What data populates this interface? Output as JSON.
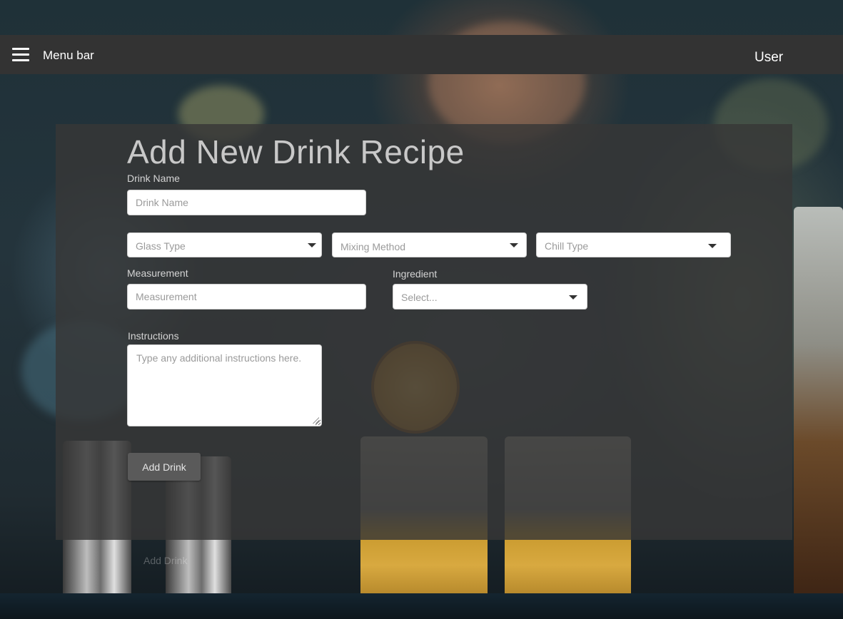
{
  "menubar": {
    "title": "Menu bar",
    "user": "User",
    "menu_icon": "hamburger-menu-icon"
  },
  "form": {
    "heading": "Add New Drink Recipe",
    "drink_name": {
      "label": "Drink Name",
      "placeholder": "Drink Name"
    },
    "glass_type": {
      "value": "Glass Type"
    },
    "mixing_method": {
      "value": "Mixing Method"
    },
    "chill_type": {
      "value": "Chill Type"
    },
    "measurement": {
      "label": "Measurement",
      "placeholder": "Measurement"
    },
    "ingredient": {
      "label": "Ingredient",
      "value": "Select..."
    },
    "instructions": {
      "label": "Instructions",
      "placeholder": "Type any additional instructions here."
    },
    "submit_label": "Add Drink"
  },
  "background": {
    "ghost_button_label": "Add Drink"
  },
  "colors": {
    "menubar_bg": "#333333",
    "panel_bg": "#373737",
    "button_bg": "#5a5a5a"
  }
}
